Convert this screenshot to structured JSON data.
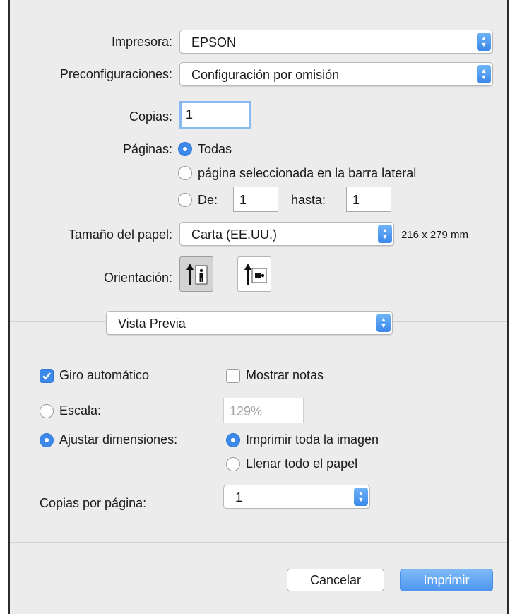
{
  "printer": {
    "label": "Impresora:",
    "value": "EPSON"
  },
  "presets": {
    "label": "Preconfiguraciones:",
    "value": "Configuración por omisión"
  },
  "copies": {
    "label": "Copias:",
    "value": "1"
  },
  "pages": {
    "label": "Páginas:",
    "all_label": "Todas",
    "selected_label": "página seleccionada en la barra lateral",
    "from_label": "De:",
    "from_value": "1",
    "to_label": "hasta:",
    "to_value": "1",
    "selected_option": "all"
  },
  "paper_size": {
    "label": "Tamaño del papel:",
    "value": "Carta (EE.UU.)",
    "dimensions": "216 x 279 mm"
  },
  "orientation": {
    "label": "Orientación:",
    "selected": "portrait"
  },
  "section_popup": {
    "value": "Vista Previa"
  },
  "preview": {
    "auto_rotate": {
      "label": "Giro automático",
      "checked": true
    },
    "show_notes": {
      "label": "Mostrar notas",
      "checked": false
    },
    "scale": {
      "label": "Escala:",
      "value": "129%"
    },
    "fit": {
      "label": "Ajustar dimensiones:",
      "selected": true
    },
    "print_entire": {
      "label": "Imprimir toda la imagen",
      "selected": true
    },
    "fill_paper": {
      "label": "Llenar todo el papel",
      "selected": false
    },
    "copies_per_page": {
      "label": "Copias por página:",
      "value": "1"
    }
  },
  "buttons": {
    "cancel": "Cancelar",
    "print": "Imprimir"
  },
  "colors": {
    "accent": "#3d89ea",
    "window_bg": "#ececec"
  }
}
